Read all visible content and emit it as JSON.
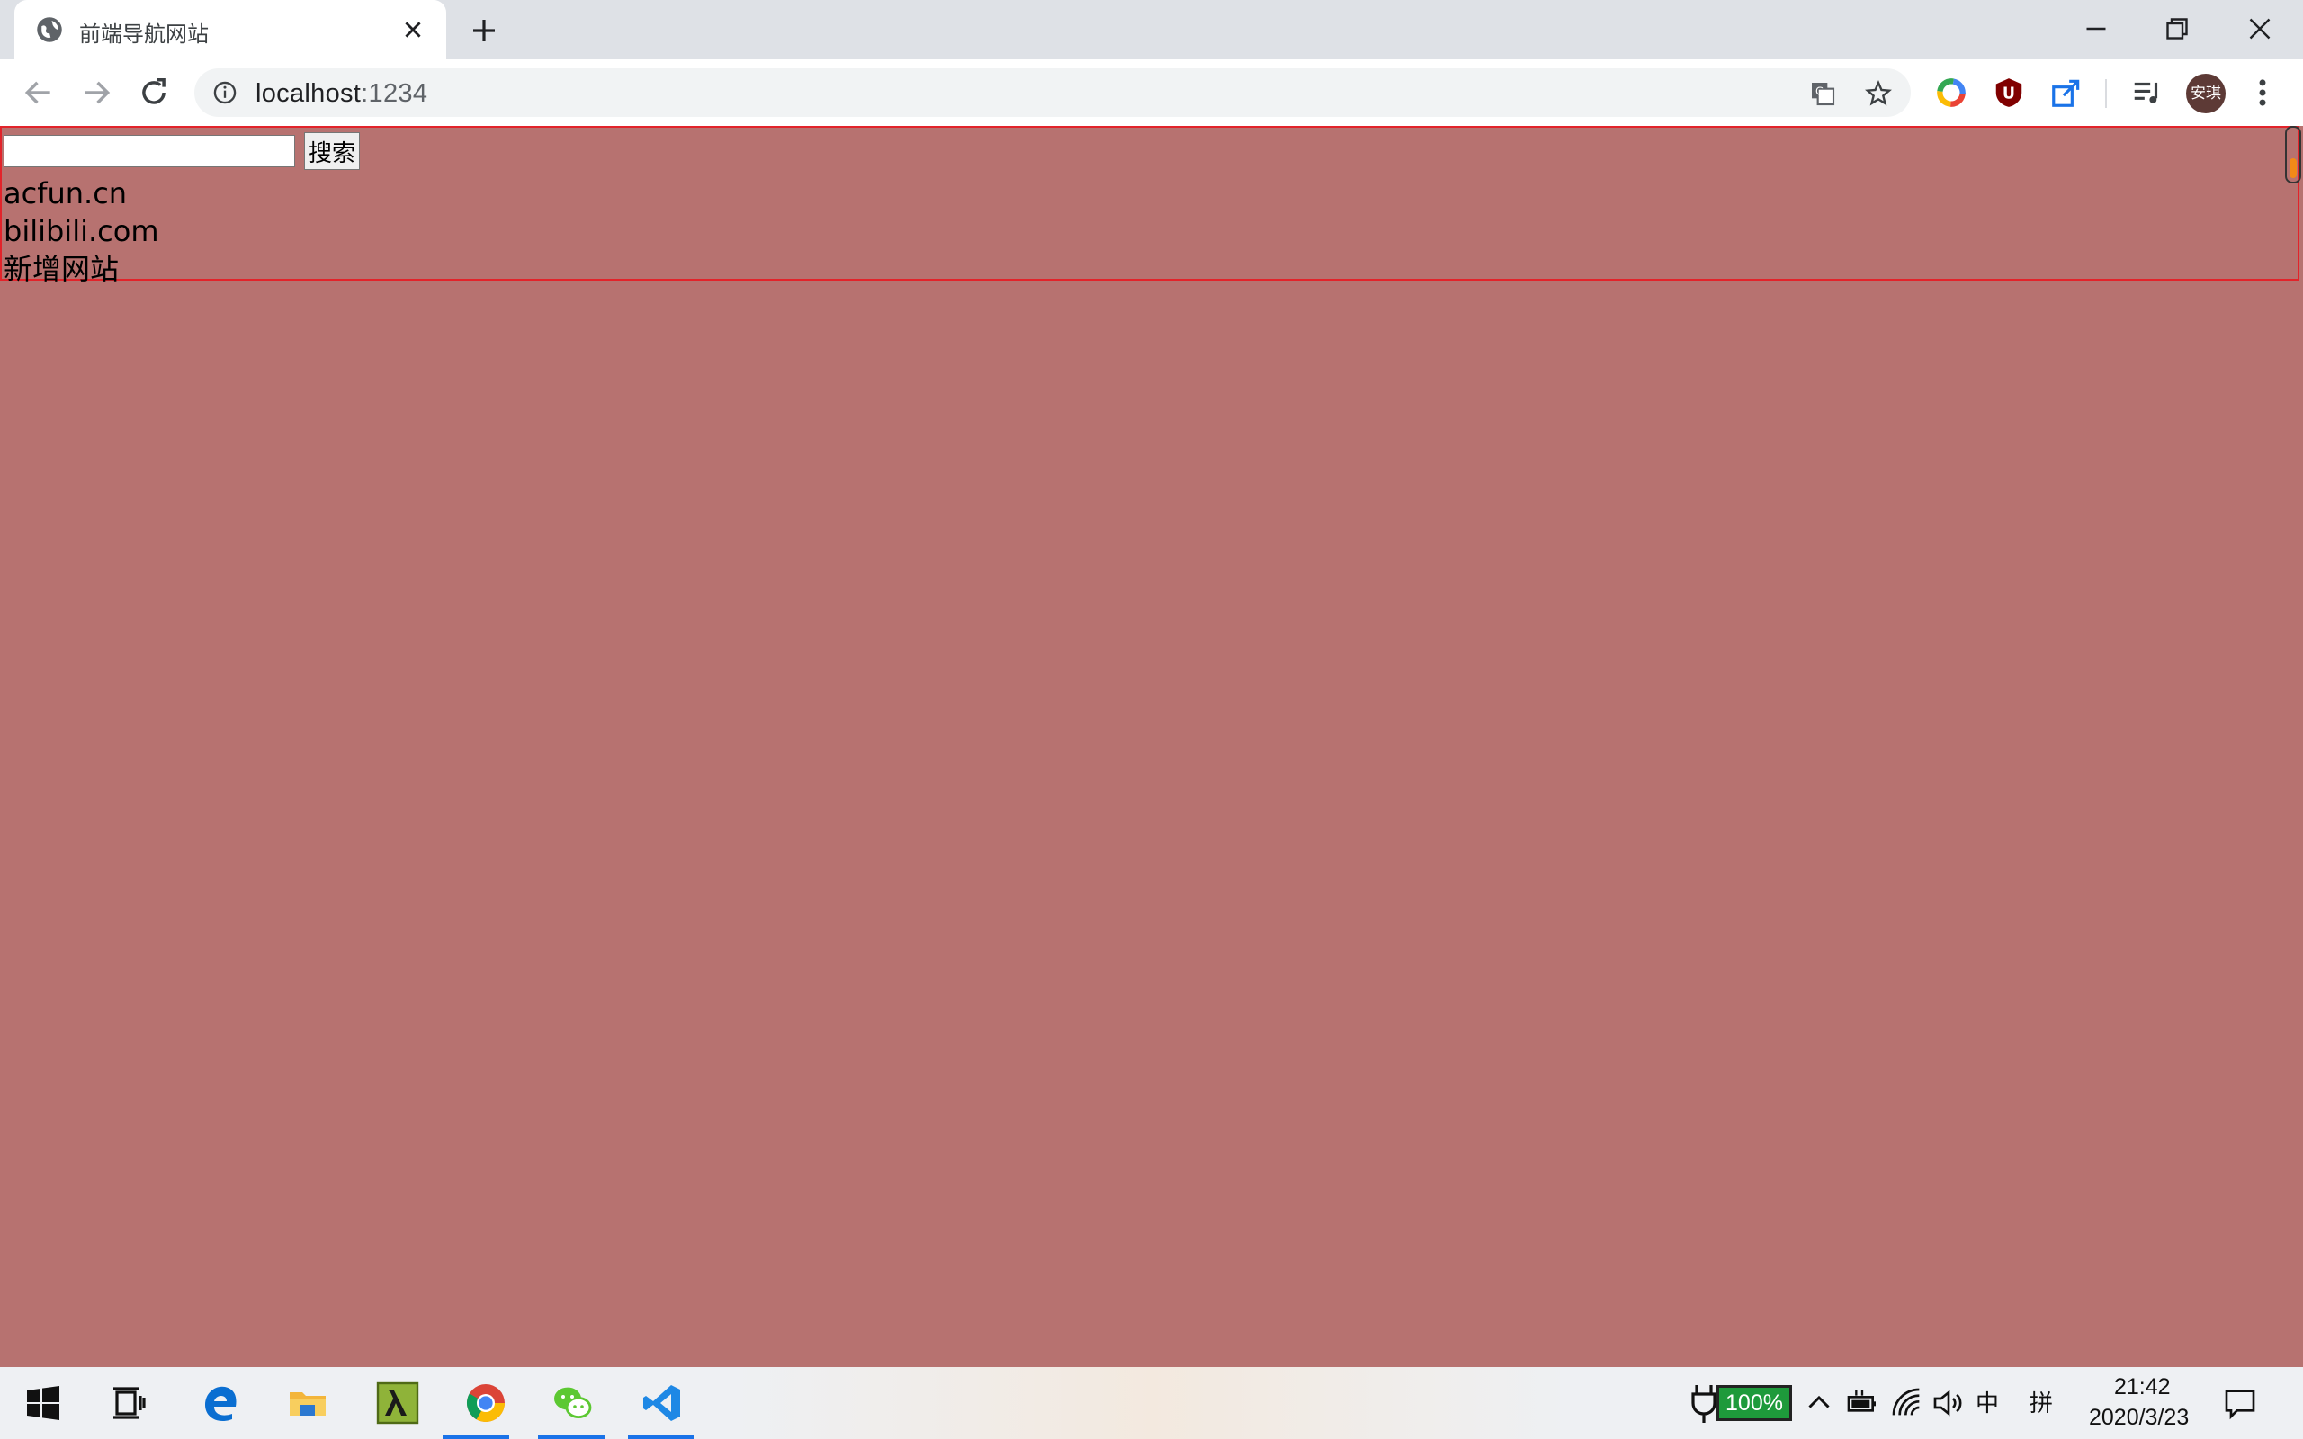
{
  "browser": {
    "tab_title": "前端导航网站",
    "url_host": "localhost",
    "url_port": ":1234",
    "avatar_text": "安琪"
  },
  "page": {
    "search_input_value": "",
    "search_button_label": "搜索",
    "links": [
      "acfun.cn",
      "bilibili.com",
      "新增网站"
    ],
    "background_color": "#b77270",
    "border_color": "#e2232a"
  },
  "taskbar": {
    "battery_label": "100%",
    "ime_mode": "中",
    "ime_layout": "拼",
    "time": "21:42",
    "date": "2020/3/23"
  },
  "icons": {
    "tab_favicon": "globe-icon",
    "windows_start": "windows-logo-icon",
    "task_view": "task-view-icon",
    "edge": "edge-icon",
    "explorer": "folder-icon",
    "lambda_app": "lambda-icon",
    "chrome": "chrome-icon",
    "wechat": "wechat-icon",
    "vscode": "vscode-icon"
  }
}
